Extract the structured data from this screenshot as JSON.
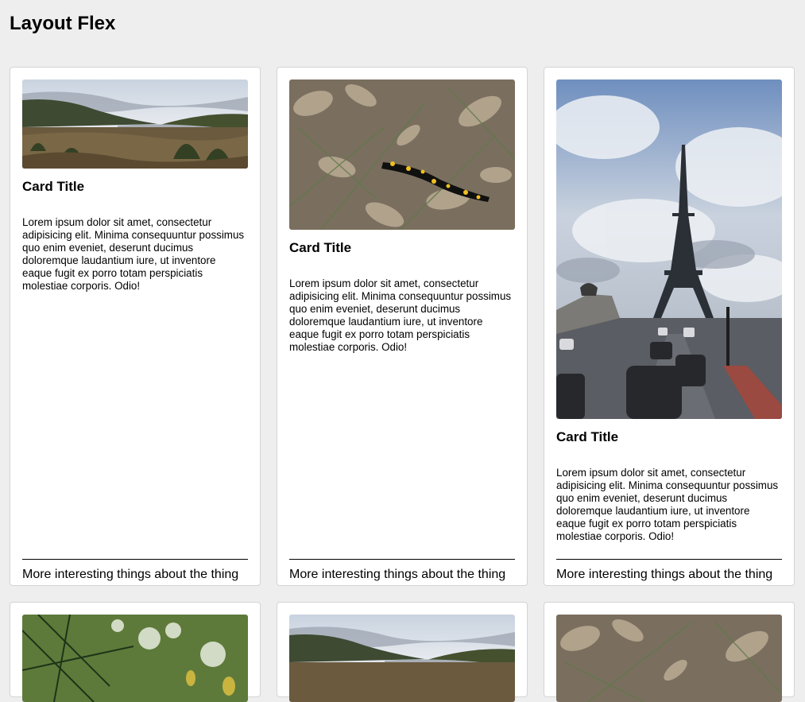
{
  "page": {
    "title": "Layout Flex"
  },
  "cards": [
    {
      "image": "landscape-valley-photo",
      "title": "Card Title",
      "text": "Lorem ipsum dolor sit amet, consectetur adipisicing elit. Minima consequuntur possimus quo enim eveniet, deserunt ducimus doloremque laudantium iure, ut inventore eaque fugit ex porro totam perspiciatis molestiae corporis. Odio!",
      "footer": "More interesting things about the thing"
    },
    {
      "image": "salamander-leaves-photo",
      "title": "Card Title",
      "text": "Lorem ipsum dolor sit amet, consectetur adipisicing elit. Minima consequuntur possimus quo enim eveniet, deserunt ducimus doloremque laudantium iure, ut inventore eaque fugit ex porro totam perspiciatis molestiae corporis. Odio!",
      "footer": "More interesting things about the thing"
    },
    {
      "image": "eiffel-tower-photo",
      "title": "Card Title",
      "text": "Lorem ipsum dolor sit amet, consectetur adipisicing elit. Minima consequuntur possimus quo enim eveniet, deserunt ducimus doloremque laudantium iure, ut inventore eaque fugit ex porro totam perspiciatis molestiae corporis. Odio!",
      "footer": "More interesting things about the thing"
    },
    {
      "image": "pine-branches-photo"
    },
    {
      "image": "landscape-valley-photo"
    },
    {
      "image": "salamander-leaves-photo"
    }
  ]
}
